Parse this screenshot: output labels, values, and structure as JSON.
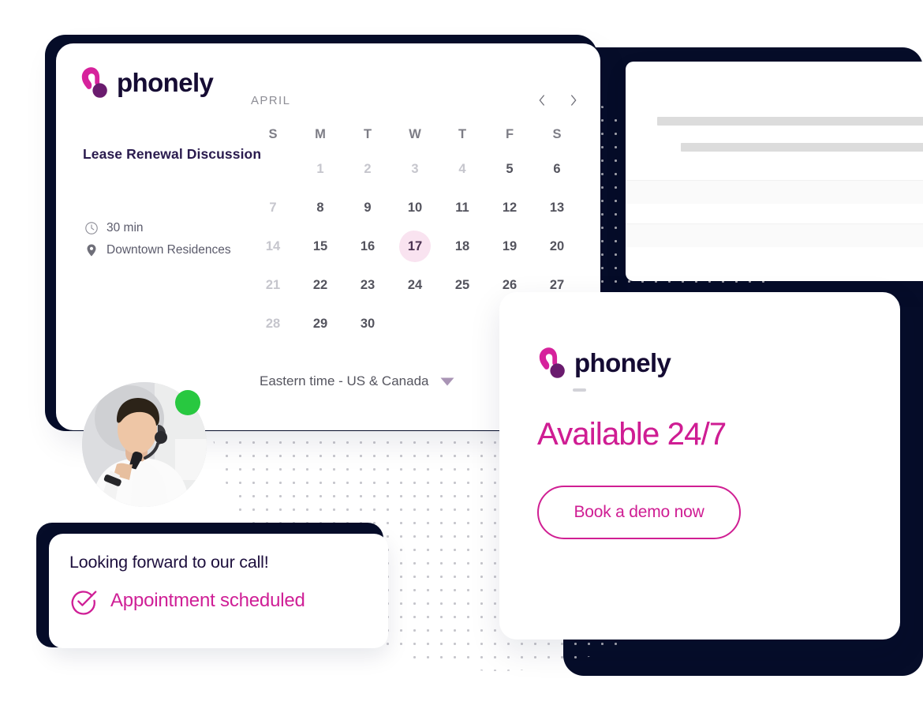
{
  "brand": {
    "name": "phonely",
    "logo_icon": "phonely-handset-logo",
    "pink": "#d6229c",
    "purple": "#6a1b6e",
    "magenta": "#cf1d93",
    "navy": "#060d29"
  },
  "booking_card": {
    "event_title": "Lease Renewal Discussion",
    "duration": {
      "icon": "clock-icon",
      "label": "30 min"
    },
    "location": {
      "icon": "map-pin-icon",
      "label": "Downtown Residences"
    },
    "calendar": {
      "month": "APRIL",
      "prev_icon": "chevron-left-icon",
      "next_icon": "chevron-right-icon",
      "weekdays": [
        "S",
        "M",
        "T",
        "W",
        "T",
        "F",
        "S"
      ],
      "selected_day": "17",
      "weeks": [
        [
          {
            "label": "",
            "state": "empty"
          },
          {
            "label": "1",
            "state": "dim"
          },
          {
            "label": "2",
            "state": "dim"
          },
          {
            "label": "3",
            "state": "dim"
          },
          {
            "label": "4",
            "state": "dim"
          },
          {
            "label": "5",
            "state": "active"
          },
          {
            "label": "6",
            "state": "active"
          }
        ],
        [
          {
            "label": "7",
            "state": "dim"
          },
          {
            "label": "8",
            "state": "active"
          },
          {
            "label": "9",
            "state": "active"
          },
          {
            "label": "10",
            "state": "active"
          },
          {
            "label": "11",
            "state": "active"
          },
          {
            "label": "12",
            "state": "active"
          },
          {
            "label": "13",
            "state": "active"
          }
        ],
        [
          {
            "label": "14",
            "state": "dim"
          },
          {
            "label": "15",
            "state": "active"
          },
          {
            "label": "16",
            "state": "active"
          },
          {
            "label": "17",
            "state": "selected"
          },
          {
            "label": "18",
            "state": "active"
          },
          {
            "label": "19",
            "state": "active"
          },
          {
            "label": "20",
            "state": "active"
          }
        ],
        [
          {
            "label": "21",
            "state": "dim"
          },
          {
            "label": "22",
            "state": "active"
          },
          {
            "label": "23",
            "state": "active"
          },
          {
            "label": "24",
            "state": "active"
          },
          {
            "label": "25",
            "state": "active"
          },
          {
            "label": "26",
            "state": "active"
          },
          {
            "label": "27",
            "state": "active"
          }
        ],
        [
          {
            "label": "28",
            "state": "dim"
          },
          {
            "label": "29",
            "state": "active"
          },
          {
            "label": "30",
            "state": "active"
          },
          {
            "label": "",
            "state": "empty"
          },
          {
            "label": "",
            "state": "empty"
          },
          {
            "label": "",
            "state": "empty"
          },
          {
            "label": "",
            "state": "empty"
          }
        ]
      ]
    },
    "timezone": {
      "label": "Eastern time - US & Canada",
      "caret_icon": "caret-down-icon"
    }
  },
  "agent": {
    "avatar_icon": "agent-avatar-photo",
    "status_icon": "online-status-dot"
  },
  "note_card": {
    "message": "Looking forward to our call!",
    "status_icon": "check-circle-icon",
    "status": "Appointment scheduled"
  },
  "cta_card": {
    "headline": "Available 24/7",
    "button_label": "Book a demo now"
  }
}
